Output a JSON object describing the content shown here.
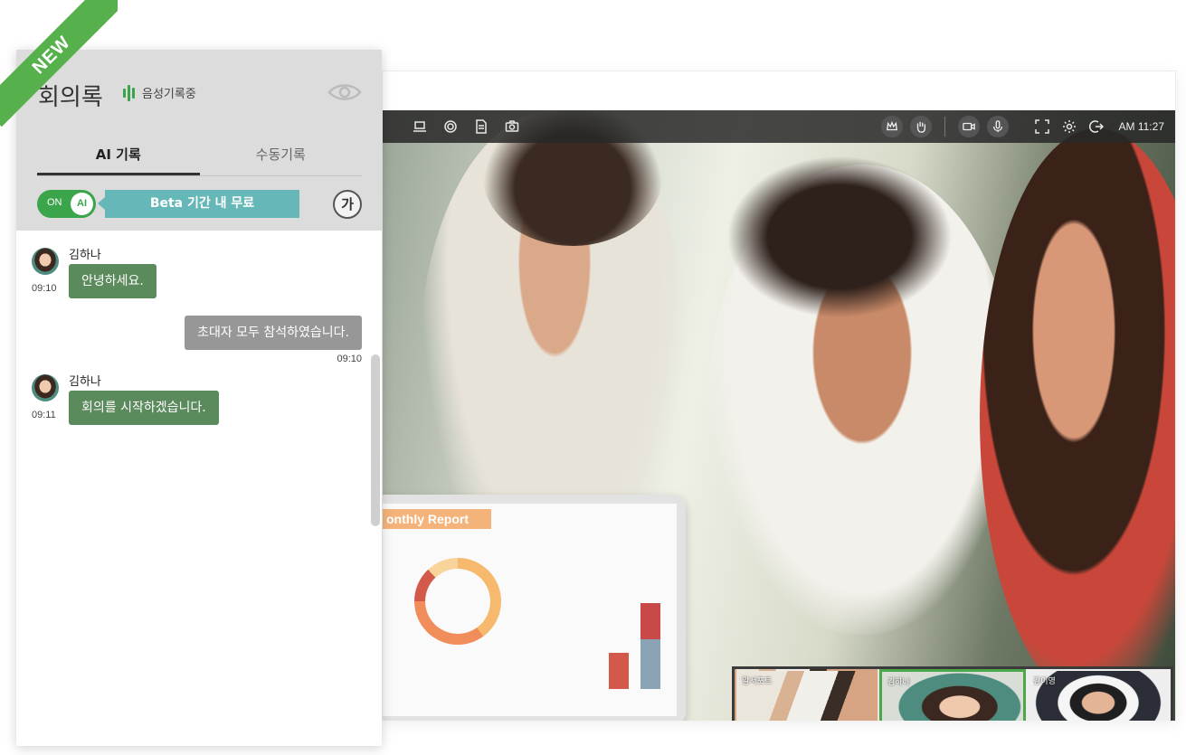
{
  "badge": "NEW",
  "notes": {
    "title": "회의록",
    "recording_label": "음성기록중",
    "tabs": [
      {
        "label": "AI 기록",
        "active": true
      },
      {
        "label": "수동기록",
        "active": false
      }
    ],
    "toggle": {
      "state_label": "ON",
      "knob_label": "AI",
      "on": true
    },
    "beta_label": "Beta 기간 내 무료",
    "font_button_label": "가",
    "icons": [
      "eye-icon"
    ],
    "messages": [
      {
        "sender": "김하나",
        "time": "09:10",
        "text": "안녕하세요.",
        "side": "left"
      },
      {
        "sender": "",
        "time": "09:10",
        "text": "초대자 모두 참석하였습니다.",
        "side": "right"
      },
      {
        "sender": "김하나",
        "time": "09:11",
        "text": "회의를 시작하겠습니다.",
        "side": "left"
      }
    ]
  },
  "video": {
    "toolbar_left_icons": [
      "laptop-icon",
      "target-icon",
      "document-icon",
      "camera-icon"
    ],
    "toolbar_right_icons": [
      "crown-icon",
      "hand-icon",
      "video-camera-icon",
      "microphone-icon",
      "fullscreen-icon",
      "gear-icon",
      "exit-icon"
    ],
    "clock": "AM 11:27",
    "report_title": "onthly Report",
    "thumbnails": [
      {
        "name": "알서포트",
        "active": false
      },
      {
        "name": "김하나",
        "active": true
      },
      {
        "name": "김이영",
        "active": false
      }
    ]
  },
  "colors": {
    "accent_green": "#3aa54a",
    "bubble_green": "#5b8a5d",
    "bubble_gray": "#979797",
    "beta_teal": "#66b7b8",
    "header_gray": "#dcdcdc"
  }
}
